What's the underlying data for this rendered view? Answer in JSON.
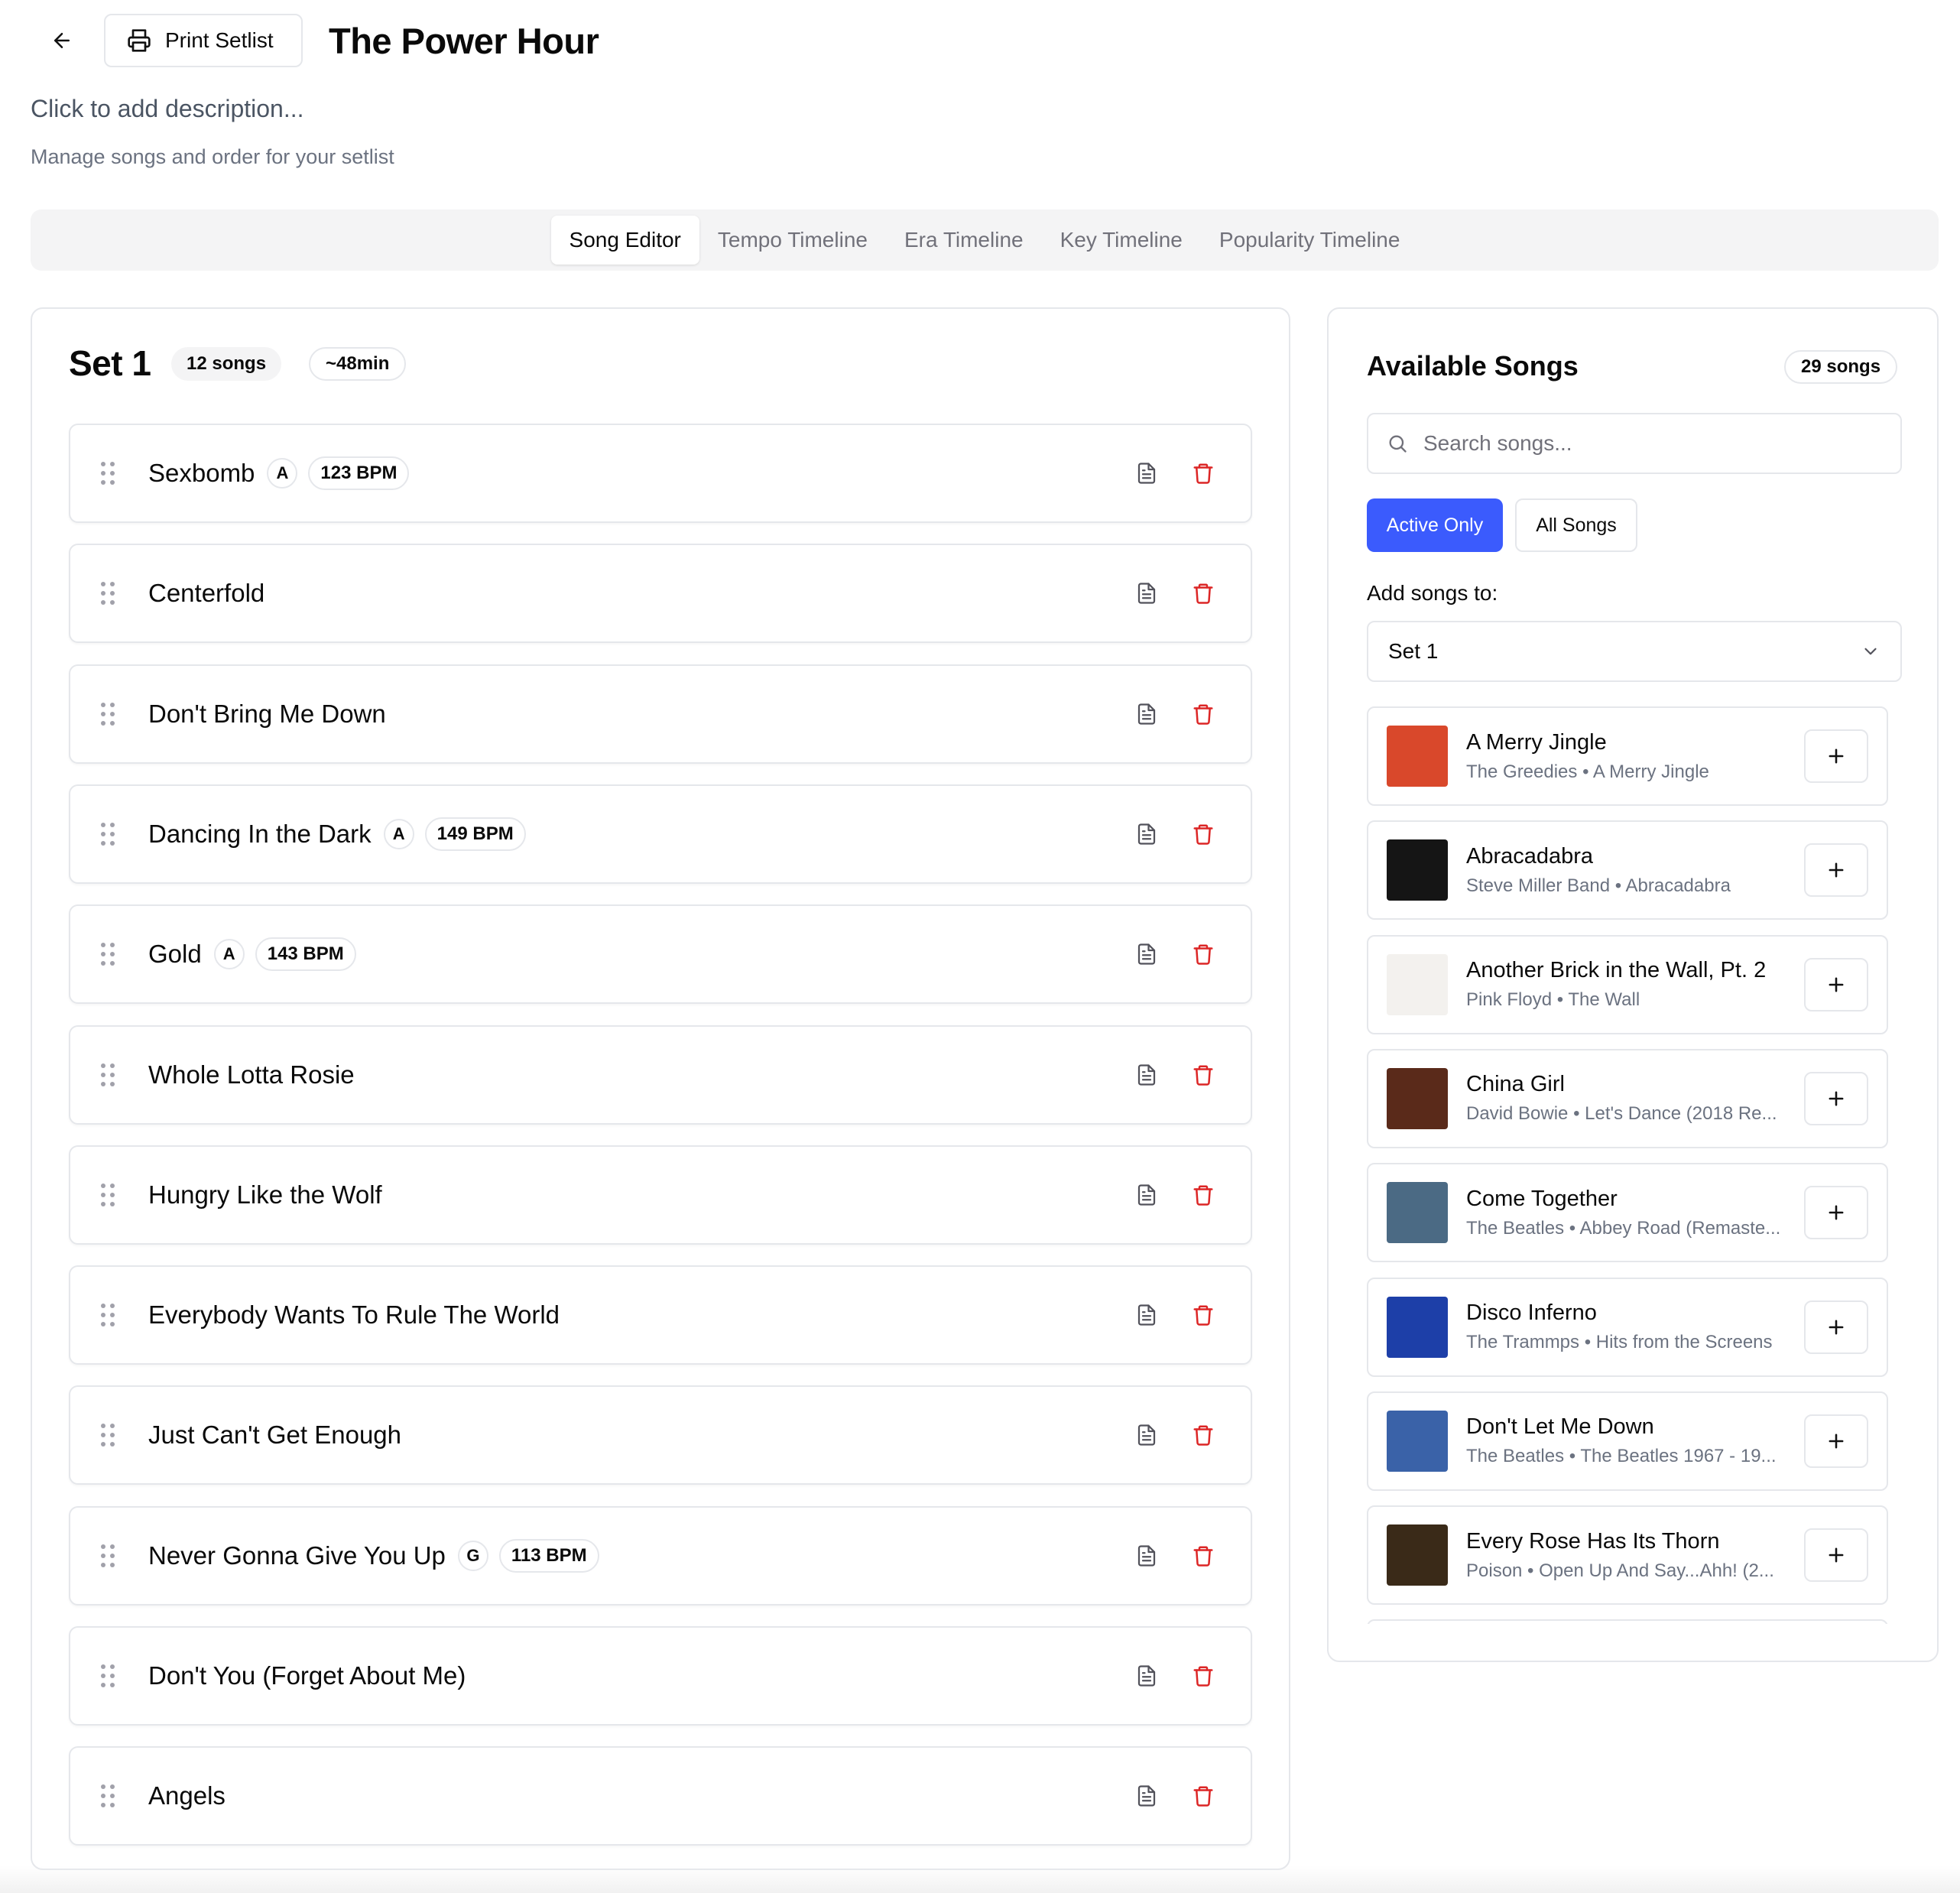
{
  "header": {
    "print_label": "Print Setlist",
    "title": "The Power Hour",
    "description": "Click to add description...",
    "subtitle": "Manage songs and order for your setlist"
  },
  "tabs": [
    {
      "label": "Song Editor",
      "active": true
    },
    {
      "label": "Tempo Timeline"
    },
    {
      "label": "Era Timeline"
    },
    {
      "label": "Key Timeline"
    },
    {
      "label": "Popularity Timeline"
    }
  ],
  "set": {
    "title": "Set 1",
    "song_count": "12 songs",
    "duration": "~48min",
    "songs": [
      {
        "title": "Sexbomb",
        "key": "A",
        "bpm": "123 BPM"
      },
      {
        "title": "Centerfold"
      },
      {
        "title": "Don't Bring Me Down"
      },
      {
        "title": "Dancing In the Dark",
        "key": "A",
        "bpm": "149 BPM"
      },
      {
        "title": "Gold",
        "key": "A",
        "bpm": "143 BPM"
      },
      {
        "title": "Whole Lotta Rosie"
      },
      {
        "title": "Hungry Like the Wolf"
      },
      {
        "title": "Everybody Wants To Rule The World"
      },
      {
        "title": "Just Can't Get Enough"
      },
      {
        "title": "Never Gonna Give You Up",
        "key": "G",
        "bpm": "113 BPM"
      },
      {
        "title": "Don't You (Forget About Me)"
      },
      {
        "title": "Angels"
      }
    ]
  },
  "available": {
    "title": "Available Songs",
    "count": "29 songs",
    "search_placeholder": "Search songs...",
    "filter_active": "Active Only",
    "filter_all": "All Songs",
    "add_to_label": "Add songs to:",
    "add_to_value": "Set 1",
    "songs": [
      {
        "title": "A Merry Jingle",
        "subtitle": "The Greedies • A Merry Jingle",
        "art_color": "#d9482b"
      },
      {
        "title": "Abracadabra",
        "subtitle": "Steve Miller Band • Abracadabra",
        "art_color": "#151515"
      },
      {
        "title": "Another Brick in the Wall, Pt. 2",
        "subtitle": "Pink Floyd • The Wall",
        "art_color": "#f3f1ee"
      },
      {
        "title": "China Girl",
        "subtitle": "David Bowie • Let's Dance (2018 Re...",
        "art_color": "#5a2a1a"
      },
      {
        "title": "Come Together",
        "subtitle": "The Beatles • Abbey Road (Remaste...",
        "art_color": "#4b6a84"
      },
      {
        "title": "Disco Inferno",
        "subtitle": "The Trammps • Hits from the Screens",
        "art_color": "#1d3fa8"
      },
      {
        "title": "Don't Let Me Down",
        "subtitle": "The Beatles • The Beatles 1967 - 19...",
        "art_color": "#3a62a8"
      },
      {
        "title": "Every Rose Has Its Thorn",
        "subtitle": "Poison • Open Up And Say...Ahh! (2...",
        "art_color": "#3a2a18"
      }
    ]
  },
  "colors": {
    "accent": "#3b5bfd",
    "danger": "#dc2626",
    "border": "#e5e7eb",
    "muted": "#6b7280"
  }
}
